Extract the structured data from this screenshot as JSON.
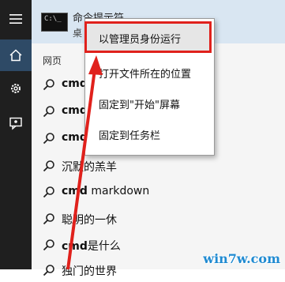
{
  "top_result": {
    "title": "命令提示符",
    "subtitle": "桌"
  },
  "section": {
    "label": "网页"
  },
  "items": [
    {
      "bold": "cmd",
      "rest": ""
    },
    {
      "bold": "cmd",
      "rest": ""
    },
    {
      "bold": "cmd",
      "rest": ""
    },
    {
      "bold": "",
      "rest": "沉默的羔羊"
    },
    {
      "bold": "cmd",
      "rest": " markdown"
    },
    {
      "bold": "",
      "rest": "聪明的一休"
    },
    {
      "bold": "cmd",
      "rest": "是什么"
    },
    {
      "bold": "",
      "rest": "独门的世界"
    }
  ],
  "context_menu": [
    "以管理员身份运行",
    "打开文件所在的位置",
    "固定到\"开始\"屏幕",
    "固定到任务栏"
  ],
  "watermark": "win7w.com",
  "colors": {
    "highlight_border": "#e0211c",
    "rail": "#1f1f1f",
    "top_result_bg": "#d9e6f2"
  }
}
